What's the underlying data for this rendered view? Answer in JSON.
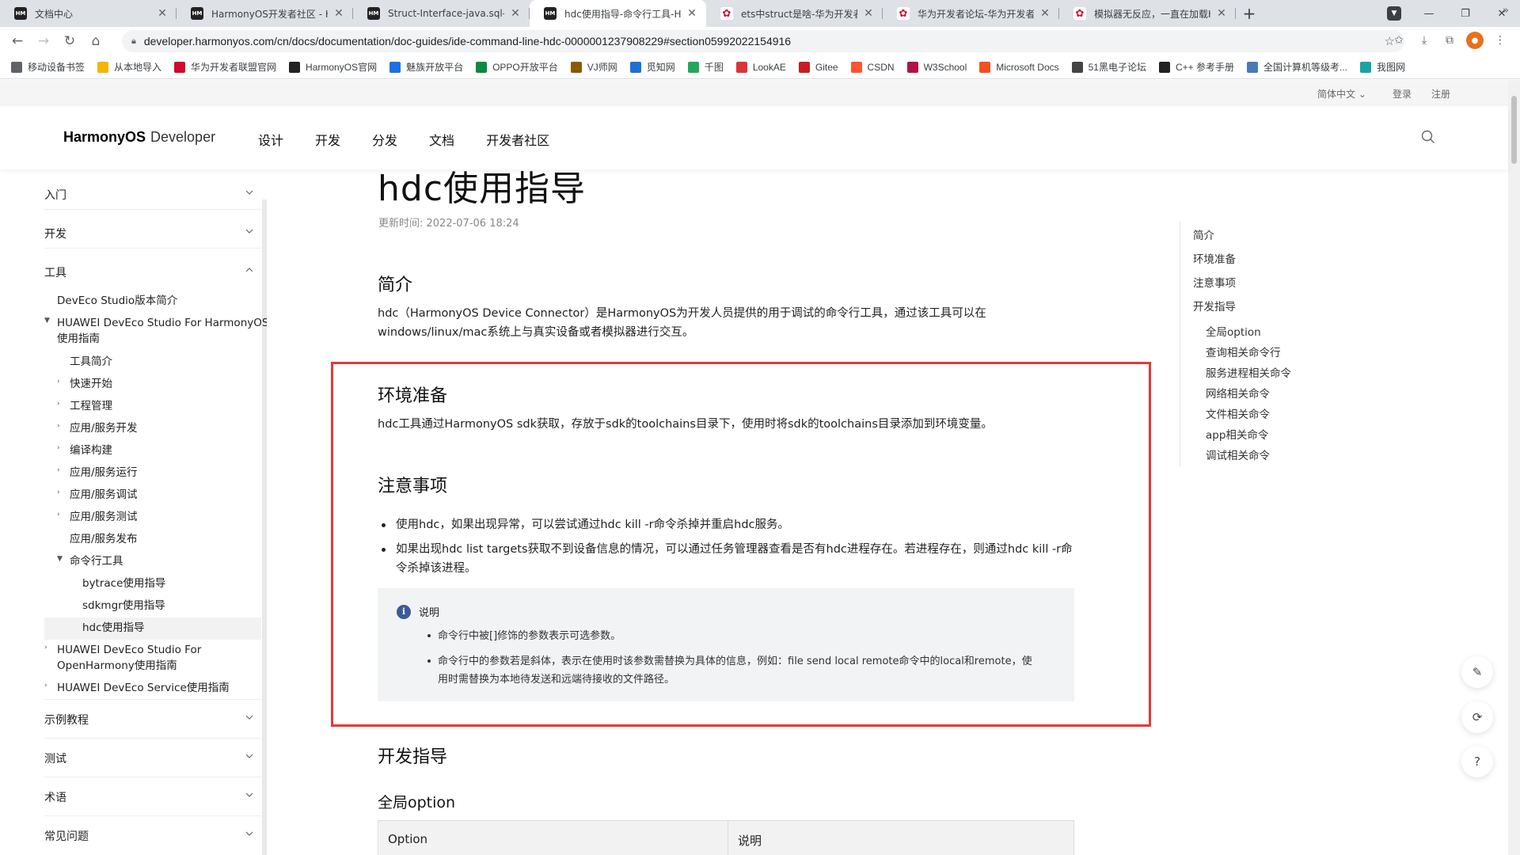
{
  "browser": {
    "tabs": [
      {
        "title": "文档中心",
        "favicon": "harmonyos-favicon",
        "active": false
      },
      {
        "title": "HarmonyOS开发者社区 - Ha",
        "favicon": "harmonyos-favicon",
        "active": false
      },
      {
        "title": "Struct-Interface-java.sql-Jav",
        "favicon": "harmonyos-favicon",
        "active": false
      },
      {
        "title": "hdc使用指导-命令行工具-HU",
        "favicon": "harmonyos-favicon",
        "active": true
      },
      {
        "title": "ets中struct是啥-华为开发者",
        "favicon": "huawei-favicon",
        "active": false
      },
      {
        "title": "华为开发者论坛-华为开发者",
        "favicon": "huawei-favicon",
        "active": false
      },
      {
        "title": "模拟器无反应，一直在加载H",
        "favicon": "huawei-favicon",
        "active": false
      }
    ],
    "new_tab_symbol": "+",
    "url": "developer.harmonyos.com/cn/docs/documentation/doc-guides/ide-command-line-hdc-0000001237908229#section05992022154916",
    "bookmarks": [
      {
        "label": "移动设备书签",
        "color": "#5f6368"
      },
      {
        "label": "从本地导入",
        "color": "#f2b600"
      },
      {
        "label": "华为开发者联盟官网",
        "color": "#cf0a2c"
      },
      {
        "label": "HarmonyOS官网",
        "color": "#222222"
      },
      {
        "label": "魅族开放平台",
        "color": "#1e6ee8"
      },
      {
        "label": "OPPO开放平台",
        "color": "#0a8a3c"
      },
      {
        "label": "VJ师网",
        "color": "#8a5a00"
      },
      {
        "label": "觅知网",
        "color": "#1f6fd1"
      },
      {
        "label": "千图",
        "color": "#23a85a"
      },
      {
        "label": "LookAE",
        "color": "#d9343a"
      },
      {
        "label": "Gitee",
        "color": "#c71d23"
      },
      {
        "label": "CSDN",
        "color": "#fc5531"
      },
      {
        "label": "W3School",
        "color": "#b3104a"
      },
      {
        "label": "Microsoft Docs",
        "color": "#f25022"
      },
      {
        "label": "51黑电子论坛",
        "color": "#444444"
      },
      {
        "label": "C++ 参考手册",
        "color": "#222222"
      },
      {
        "label": "全国计算机等级考...",
        "color": "#4a7ab8"
      },
      {
        "label": "我图网",
        "color": "#1aa3a3"
      }
    ]
  },
  "site": {
    "language": "简体中文",
    "login": "登录",
    "register": "注册",
    "logo_bold": "HarmonyOS",
    "logo_light": "Developer",
    "nav": [
      "设计",
      "开发",
      "分发",
      "文档",
      "开发者社区"
    ]
  },
  "sidebar": {
    "sections": [
      "入门",
      "开发",
      "工具",
      "示例教程",
      "测试",
      "术语",
      "常见问题"
    ],
    "tree": [
      {
        "label": "DevEco Studio版本简介"
      },
      {
        "label": "HUAWEI DevEco Studio For HarmonyOS",
        "label2": "使用指南"
      },
      {
        "label": "工具简介"
      },
      {
        "label": "快速开始"
      },
      {
        "label": "工程管理"
      },
      {
        "label": "应用/服务开发"
      },
      {
        "label": "编译构建"
      },
      {
        "label": "应用/服务运行"
      },
      {
        "label": "应用/服务调试"
      },
      {
        "label": "应用/服务测试"
      },
      {
        "label": "应用/服务发布"
      },
      {
        "label": "命令行工具"
      },
      {
        "label": "bytrace使用指导"
      },
      {
        "label": "sdkmgr使用指导"
      },
      {
        "label": "hdc使用指导"
      },
      {
        "label": "HUAWEI DevEco Studio For",
        "label2": "OpenHarmony使用指南"
      },
      {
        "label": "HUAWEI DevEco Service使用指南"
      }
    ]
  },
  "doc": {
    "title": "hdc使用指导",
    "updated": "更新时间: 2022-07-06 18:24",
    "intro_heading": "简介",
    "intro_text": "hdc（HarmonyOS Device Connector）是HarmonyOS为开发人员提供的用于调试的命令行工具，通过该工具可以在windows/linux/mac系统上与真实设备或者模拟器进行交互。",
    "env_heading": "环境准备",
    "env_text": "hdc工具通过HarmonyOS sdk获取，存放于sdk的toolchains目录下，使用时将sdk的toolchains目录添加到环境变量。",
    "notes_heading": "注意事项",
    "notes": [
      "使用hdc，如果出现异常，可以尝试通过hdc kill -r命令杀掉并重启hdc服务。",
      "如果出现hdc list targets获取不到设备信息的情况，可以通过任务管理器查看是否有hdc进程存在。若进程存在，则通过hdc kill -r命令杀掉该进程。"
    ],
    "callout_title": "说明",
    "callout_items": [
      "命令行中被[]修饰的参数表示可选参数。",
      "命令行中的参数若是斜体，表示在使用时该参数需替换为具体的信息，例如：file send local remote命令中的local和remote，使用时需替换为本地待发送和远端待接收的文件路径。"
    ],
    "dev_heading": "开发指导",
    "global_heading": "全局option",
    "table_headers": [
      "Option",
      "说明"
    ]
  },
  "toc": [
    "简介",
    "环境准备",
    "注意事项",
    "开发指导",
    "全局option",
    "查询相关命令行",
    "服务进程相关命令",
    "网络相关命令",
    "文件相关命令",
    "app相关命令",
    "调试相关命令"
  ],
  "colors": {
    "highlight_box": "#e53935",
    "callout_icon": "#3c5a9a"
  }
}
